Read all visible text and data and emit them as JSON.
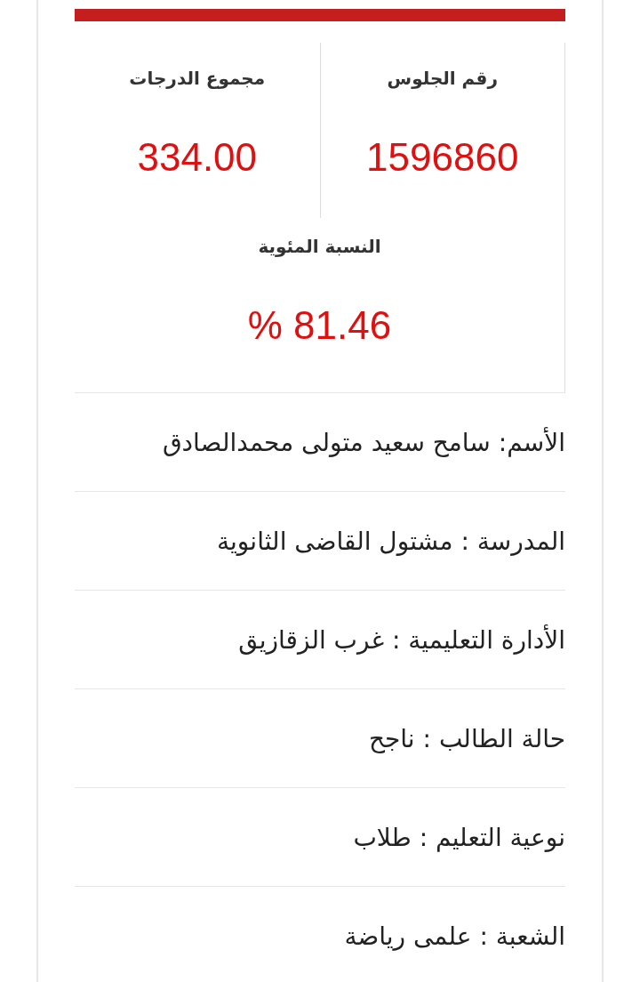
{
  "stats": [
    {
      "label": "رقم الجلوس",
      "value": "1596860"
    },
    {
      "label": "مجموع الدرجات",
      "value": "334.00"
    }
  ],
  "percentage": {
    "label": "النسبة المئوية",
    "value": "% 81.46"
  },
  "details": [
    "الأسم: سامح سعيد متولى محمدالصادق",
    "المدرسة : مشتول القاضى الثانوية",
    "الأدارة التعليمية : غرب الزقازيق",
    "حالة الطالب : ناجح",
    "نوعية التعليم : طلاب",
    "الشعبة : علمى رياضة"
  ]
}
